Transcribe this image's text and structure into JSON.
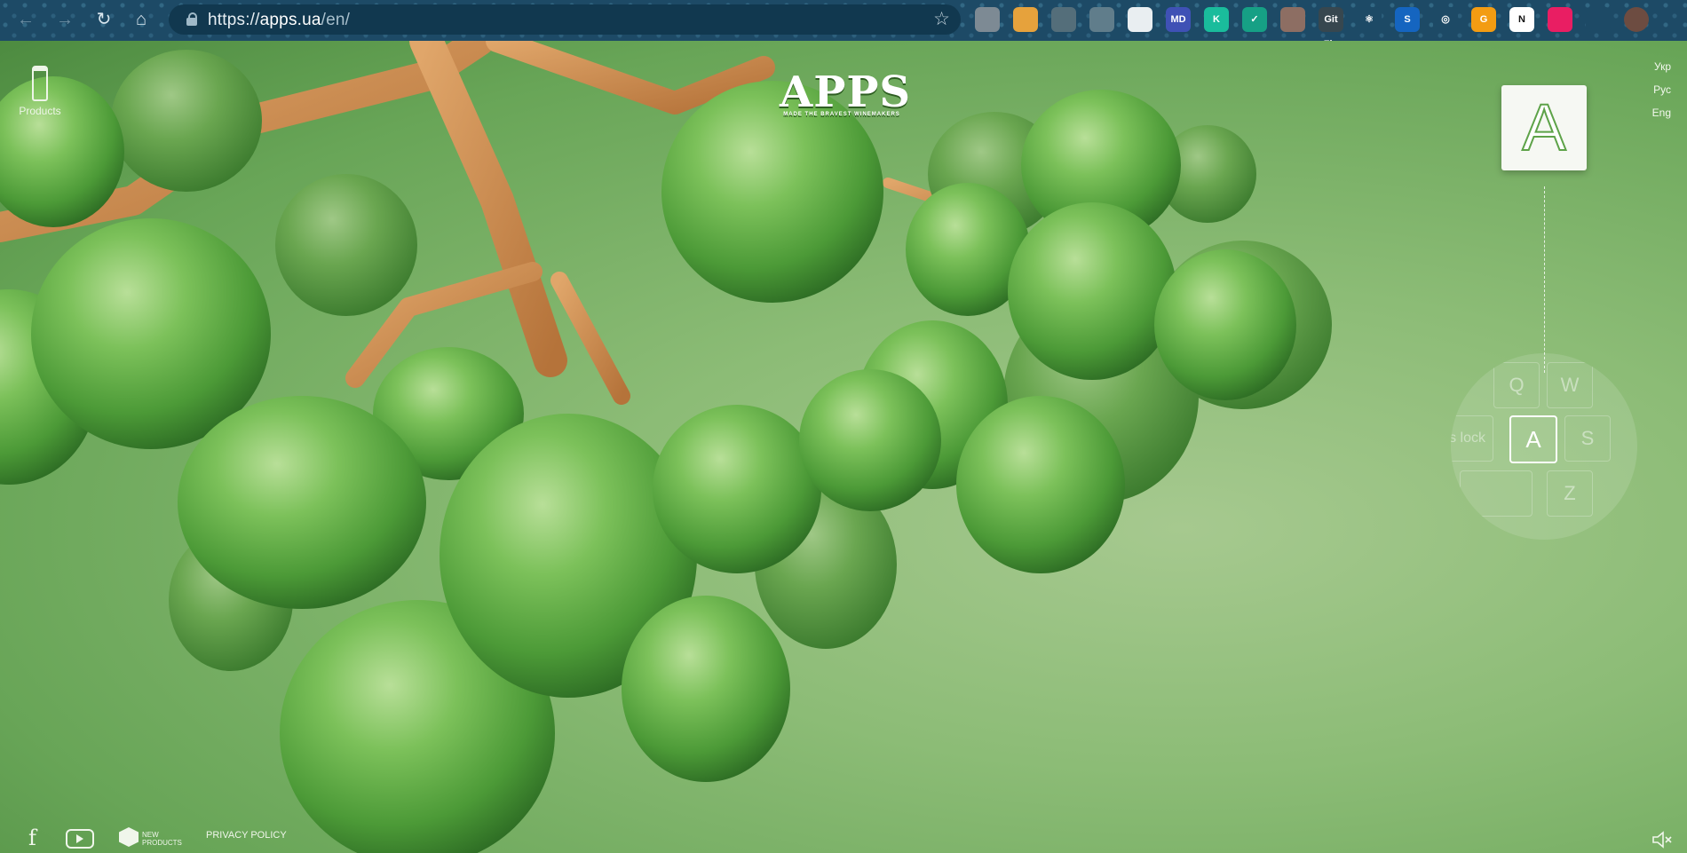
{
  "browser": {
    "url_scheme": "https://",
    "url_host": "apps.ua",
    "url_path": "/en/",
    "extensions": [
      {
        "icon": "camera-ext-icon",
        "label": "",
        "color": "#7d8a94"
      },
      {
        "icon": "palette-ext-icon",
        "label": "",
        "color": "#e6a23c"
      },
      {
        "icon": "cube-ext-icon",
        "label": "",
        "color": "#546e7a"
      },
      {
        "icon": "image-ext-icon",
        "label": "",
        "color": "#607d8b"
      },
      {
        "icon": "gear-ext-icon",
        "label": "",
        "color": "#e9eef1"
      },
      {
        "icon": "md-ext-icon",
        "label": "MD",
        "color": "#3f51b5"
      },
      {
        "icon": "k-ext-icon",
        "label": "K",
        "color": "#1abc9c"
      },
      {
        "icon": "check-ext-icon",
        "label": "✓",
        "color": "#16a085"
      },
      {
        "icon": "hand-ext-icon",
        "label": "",
        "color": "#8d6e63"
      },
      {
        "icon": "gitzip-ext-icon",
        "label": "Git Zip",
        "color": "#37474f"
      },
      {
        "icon": "react-ext-icon",
        "label": "⚛",
        "color": "#1d4a66"
      },
      {
        "icon": "s-ext-icon",
        "label": "S",
        "color": "#1565c0"
      },
      {
        "icon": "target-ext-icon",
        "label": "◎",
        "color": "#1d4a66"
      },
      {
        "icon": "g-ext-icon",
        "label": "G",
        "color": "#f39c12"
      },
      {
        "icon": "notion-ext-icon",
        "label": "N",
        "color": "#ffffff"
      },
      {
        "icon": "color-wheel-ext-icon",
        "label": "",
        "color": "#e91e63"
      },
      {
        "icon": "puzzle-ext-icon",
        "label": "",
        "color": "#1d4a66"
      },
      {
        "icon": "profile-avatar-icon",
        "label": "",
        "color": "#6d4c41"
      }
    ]
  },
  "site": {
    "logo": "APPS",
    "logo_tagline": "MADE THE BRAVEST WINEMAKERS",
    "products_label": "Products",
    "languages": [
      "Укр",
      "Рус",
      "Eng"
    ],
    "key_letter": "A",
    "keyboard_keys": [
      "Q",
      "W",
      "s lock",
      "A",
      "S",
      "Z"
    ],
    "footer": {
      "new_products_line1": "NEW",
      "new_products_line2": "PRODUCTS",
      "privacy_label": "PRIVACY POLICY"
    }
  },
  "colors": {
    "background_green": "#7fb06a",
    "apple_green": "#5fa84a",
    "branch_wood": "#c98b4e",
    "chrome_blue": "#1d4a66"
  }
}
